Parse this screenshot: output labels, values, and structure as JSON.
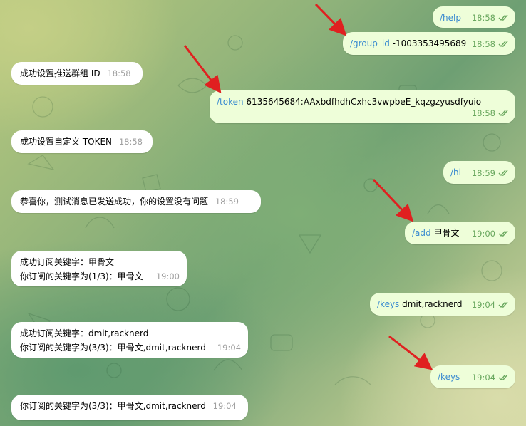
{
  "messages": {
    "help": {
      "cmd": "/help",
      "text": "",
      "time": "18:58"
    },
    "group_id": {
      "cmd": "/group_id",
      "text": " -1003353495689",
      "time": "18:58"
    },
    "set_group": {
      "text": "成功设置推送群组 ID",
      "time": "18:58"
    },
    "token": {
      "cmd": "/token",
      "text": " 6135645684:AAxbdfhdhCxhc3vwpbeE_kqzgzyusdfyuio",
      "time": "18:58"
    },
    "set_token": {
      "text": "成功设置自定义 TOKEN",
      "time": "18:58"
    },
    "hi": {
      "cmd": "/hi",
      "text": "",
      "time": "18:59"
    },
    "congrats": {
      "text": "恭喜你，测试消息已发送成功，你的设置没有问题",
      "time": "18:59"
    },
    "add": {
      "cmd": "/add",
      "text": " 甲骨文",
      "time": "19:00"
    },
    "sub1": {
      "line1": "成功订阅关键字：甲骨文",
      "line2": "你订阅的关键字为(1/3)：甲骨文",
      "time": "19:00"
    },
    "keys_add": {
      "cmd": "/keys",
      "text": " dmit,racknerd",
      "time": "19:04"
    },
    "sub2": {
      "line1": "成功订阅关键字：dmit,racknerd",
      "line2": "你订阅的关键字为(3/3)：甲骨文,dmit,racknerd",
      "time": "19:04"
    },
    "keys": {
      "cmd": "/keys",
      "text": "",
      "time": "19:04"
    },
    "list": {
      "text": "你订阅的关键字为(3/3)：甲骨文,dmit,racknerd",
      "time": "19:04"
    }
  },
  "icons": {
    "read_receipt": "double-check-icon",
    "annotation": "red-arrow"
  },
  "colors": {
    "outgoing": "#eefed9",
    "incoming": "#ffffff",
    "command": "#3a8bd0",
    "arrow": "#e02020",
    "check": "#6aa85f"
  }
}
